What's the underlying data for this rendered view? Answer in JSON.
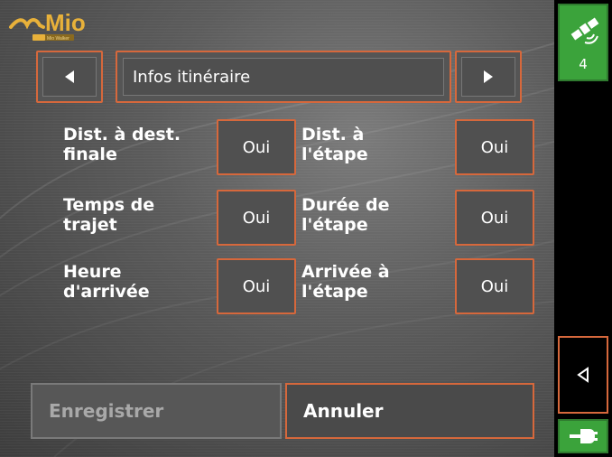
{
  "header": {
    "logo_text": "Mio",
    "logo_tagline": "Mio Walker",
    "title": "Infos itinéraire"
  },
  "options": [
    {
      "label": "Dist. à dest.\nfinale",
      "value": "Oui"
    },
    {
      "label": "Dist. à\nl'étape",
      "value": "Oui"
    },
    {
      "label": "Temps de\ntrajet",
      "value": "Oui"
    },
    {
      "label": "Durée de\nl'étape",
      "value": "Oui"
    },
    {
      "label": "Heure\nd'arrivée",
      "value": "Oui"
    },
    {
      "label": "Arrivée à\nl'étape",
      "value": "Oui"
    }
  ],
  "buttons": {
    "save": "Enregistrer",
    "cancel": "Annuler"
  },
  "sidebar": {
    "satellite_count": "4"
  },
  "icons": {
    "prev": "left-triangle-icon",
    "next": "right-triangle-icon",
    "satellite": "satellite-icon",
    "back": "back-arrow-icon",
    "power": "power-plug-icon"
  },
  "colors": {
    "accent_border": "#d6683c",
    "gps_green": "#3ba33b",
    "background": "#5c5c5c"
  }
}
